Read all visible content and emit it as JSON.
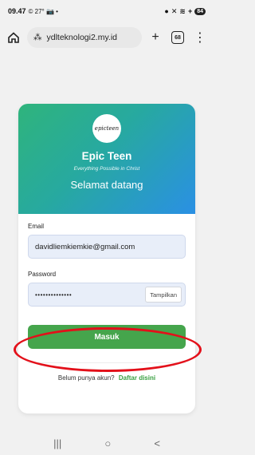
{
  "status_bar": {
    "time": "09.47",
    "indicators_left": "© 27° 📷 •",
    "battery": "84"
  },
  "browser": {
    "url": "ydlteknologi2.my.id",
    "url_prefix_symbol": "⁂",
    "tab_count": "68"
  },
  "card": {
    "brand": "Epic Teen",
    "tagline": "Everything Possible in Christ",
    "welcome": "Selamat datang",
    "logo_text": "epicteen"
  },
  "form": {
    "email_label": "Email",
    "email_value": "davidliemkiemkie@gmail.com",
    "password_label": "Password",
    "password_value": "••••••••••••••",
    "show_password_label": "Tampilkan",
    "login_label": "Masuk",
    "signup_prompt": "Belum punya akun?",
    "signup_link": "Daftar disini"
  },
  "colors": {
    "header_gradient_start": "#2fb47c",
    "header_gradient_end": "#2a90e4",
    "login_button": "#45a54c",
    "annotation": "#e3101a"
  },
  "nav": {
    "recent_icon": "|||",
    "home_icon": "○",
    "back_icon": "<"
  }
}
